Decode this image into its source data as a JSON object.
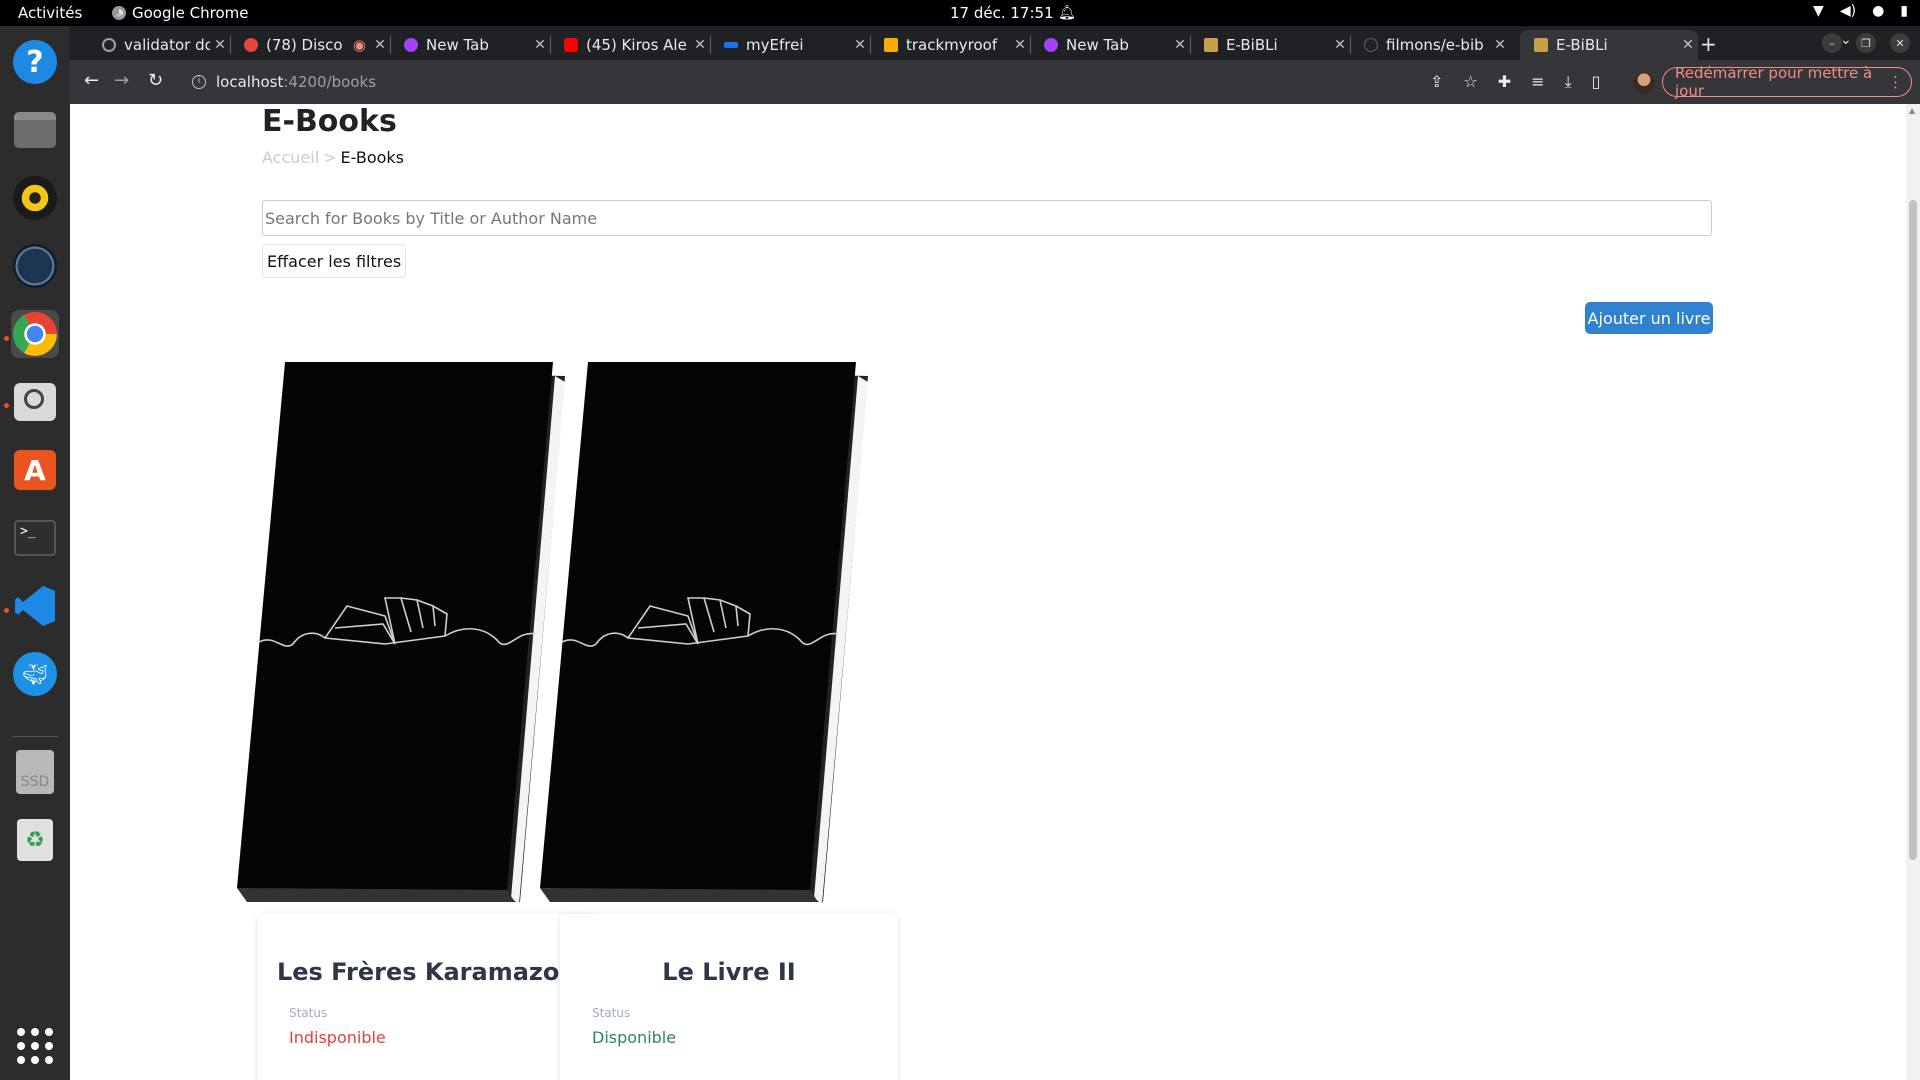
{
  "system": {
    "activities": "Activités",
    "app_name": "Google Chrome",
    "clock": "17 déc.  17:51"
  },
  "browser": {
    "tabs": [
      {
        "label": "validator don",
        "favicon_color": "#9aa0a6"
      },
      {
        "label": "(78) Disco",
        "favicon_color": "#e8453c"
      },
      {
        "label": "New Tab",
        "favicon_color": "#a142f4"
      },
      {
        "label": "(45) Kiros Ale",
        "favicon_color": "#ff0000"
      },
      {
        "label": "myEfrei",
        "favicon_color": "#1a73e8"
      },
      {
        "label": "trackmyroof",
        "favicon_color": "#f9ab00"
      },
      {
        "label": "New Tab",
        "favicon_color": "#a142f4"
      },
      {
        "label": "E-BiBLi",
        "favicon_color": "#c8a04a"
      },
      {
        "label": "filmons/e-bib",
        "favicon_color": "#202124"
      },
      {
        "label": "E-BiBLi",
        "favicon_color": "#c8a04a"
      }
    ],
    "url_host": "localhost",
    "url_path": ":4200/books",
    "update_button": "Redémarrer pour mettre à jour"
  },
  "page": {
    "title": "E-Books",
    "breadcrumb": {
      "home": "Accueil",
      "separator": ">",
      "current": "E-Books"
    },
    "search_placeholder": "Search for Books by Title or Author Name",
    "clear_filters": "Effacer les filtres",
    "add_book": "Ajouter un livre",
    "status_label": "Status",
    "books": [
      {
        "title": "Les Frères Karamazov",
        "status": "Indisponible",
        "status_color": "#e53e3e"
      },
      {
        "title": "Le Livre II",
        "status": "Disponible",
        "status_color": "#2f855a"
      }
    ]
  }
}
